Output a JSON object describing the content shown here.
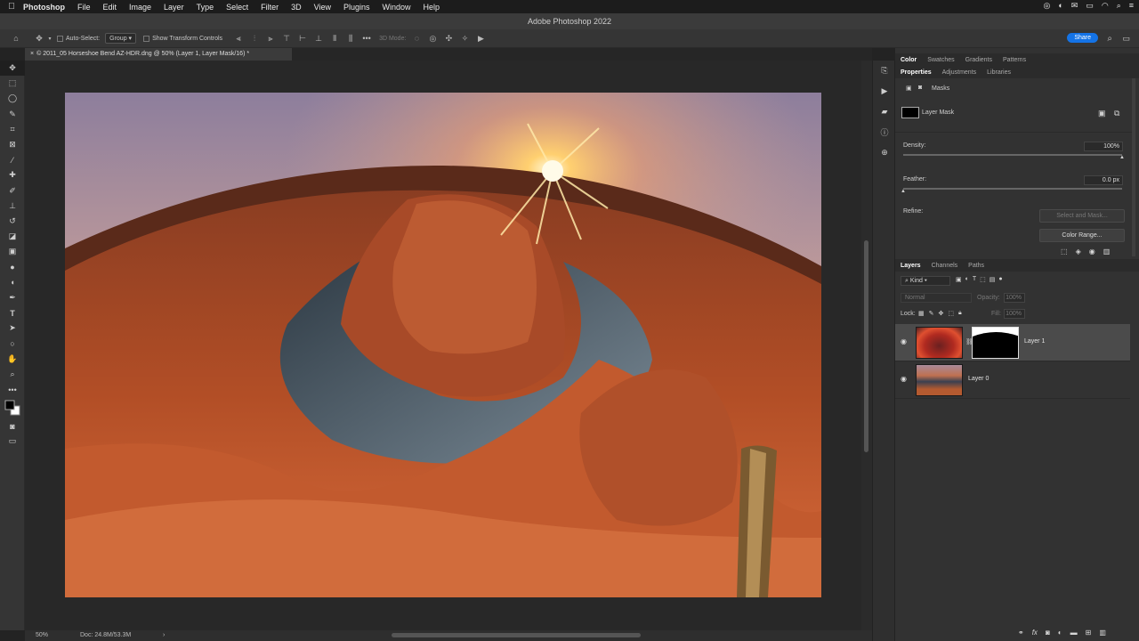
{
  "menubar": {
    "apple": "",
    "items": [
      "Photoshop",
      "File",
      "Edit",
      "Image",
      "Layer",
      "Type",
      "Select",
      "Filter",
      "3D",
      "View",
      "Plugins",
      "Window",
      "Help"
    ]
  },
  "window_title": "Adobe Photoshop 2022",
  "options_bar": {
    "auto_select_label": "Auto-Select:",
    "auto_select_value": "Group",
    "show_transform_label": "Show Transform Controls",
    "mode_3d_label": "3D Mode:",
    "share_label": "Share"
  },
  "document_tab": "© 2011_05 Horseshoe Bend AZ-HDR.dng @ 50% (Layer 1, Layer Mask/16) *",
  "status_bar": {
    "zoom": "50%",
    "doc_size": "Doc: 24.8M/53.3M"
  },
  "top_panel": {
    "tabs": [
      "Color",
      "Swatches",
      "Gradients",
      "Patterns"
    ],
    "sub_tabs": [
      "Properties",
      "Adjustments",
      "Libraries"
    ],
    "masks_label": "Masks",
    "layer_mask_label": "Layer Mask",
    "density_label": "Density:",
    "density_value": "100%",
    "density_level": 1.0,
    "feather_label": "Feather:",
    "feather_value": "0.0 px",
    "feather_level": 0.0,
    "refine_label": "Refine:",
    "select_mask_button": "Select and Mask...",
    "color_range_button": "Color Range..."
  },
  "layers_panel": {
    "tabs": [
      "Layers",
      "Channels",
      "Paths"
    ],
    "filter_kind": "Kind",
    "blend_mode": "Normal",
    "opacity_label": "Opacity:",
    "opacity_value": "100%",
    "lock_label": "Lock:",
    "fill_label": "Fill:",
    "fill_value": "100%",
    "layers": [
      {
        "name": "Layer 1",
        "selected": true,
        "has_mask": true
      },
      {
        "name": "Layer 0",
        "selected": false,
        "has_mask": false
      }
    ]
  },
  "colors": {
    "accent": "#1473e6",
    "panel_bg": "#323232",
    "canvas_bg": "#282828"
  }
}
